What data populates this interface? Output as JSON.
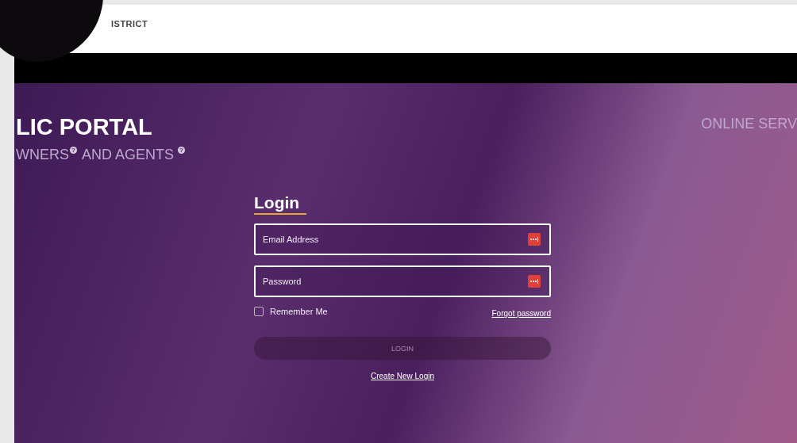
{
  "header": {
    "brand_fragment": "ISTRICT"
  },
  "hero": {
    "title": "LIC PORTAL",
    "subtitle_parts": [
      {
        "text": "WNERS",
        "help_mark": "?"
      },
      {
        "text": "AND AGENTS",
        "help_mark": "?"
      }
    ],
    "right_heading": "ONLINE SERV"
  },
  "login": {
    "title": "Login",
    "fields": [
      {
        "placeholder": "Email Address"
      },
      {
        "placeholder": "Password"
      }
    ],
    "remember": {
      "label": "Remember Me",
      "checked": false
    },
    "forgot_link": "Forgot password",
    "submit": {
      "label": "LOGIN",
      "disabled": true
    },
    "create_link": "Create New Login"
  }
}
